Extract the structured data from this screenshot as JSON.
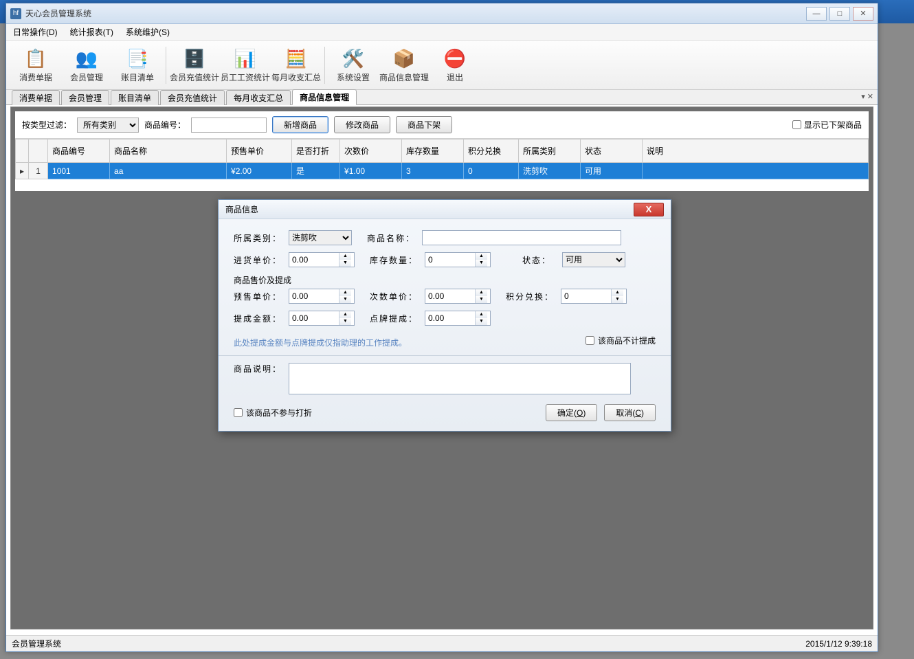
{
  "window": {
    "title": "天心会员管理系统"
  },
  "menubar": {
    "daily": "日常操作(D)",
    "report": "统计报表(T)",
    "maint": "系统维护(S)"
  },
  "toolbar": {
    "consume": "消费单据",
    "member": "会员管理",
    "ledger": "账目清单",
    "recharge": "会员充值统计",
    "salary": "员工工资统计",
    "monthly": "每月收支汇总",
    "settings": "系统设置",
    "goods": "商品信息管理",
    "exit": "退出"
  },
  "tabs": {
    "t1": "消费单据",
    "t2": "会员管理",
    "t3": "账目清单",
    "t4": "会员充值统计",
    "t5": "每月收支汇总",
    "t6": "商品信息管理"
  },
  "filter": {
    "byType": "按类型过滤：",
    "allCat": "所有类别",
    "codeLabel": "商品编号：",
    "add": "新增商品",
    "edit": "修改商品",
    "off": "商品下架",
    "showOff": "显示已下架商品"
  },
  "columns": {
    "code": "商品编号",
    "name": "商品名称",
    "price": "预售单价",
    "discount": "是否打折",
    "tprice": "次数价",
    "stock": "库存数量",
    "exchange": "积分兑换",
    "cat": "所属类别",
    "status": "状态",
    "desc": "说明"
  },
  "row": {
    "idx": "1",
    "code": "1001",
    "name": "aa",
    "price": "¥2.00",
    "discount": "是",
    "tprice": "¥1.00",
    "stock": "3",
    "exchange": "0",
    "cat": "洗剪吹",
    "status": "可用",
    "desc": ""
  },
  "dialog": {
    "title": "商品信息",
    "catLabel": "所属类别：",
    "catValue": "洗剪吹",
    "nameLabel": "商品名称：",
    "nameValue": "",
    "inPriceLabel": "进货单价：",
    "inPriceValue": "0.00",
    "stockLabel": "库存数量：",
    "stockValue": "0",
    "statusLabel": "状态：",
    "statusValue": "可用",
    "section": "商品售价及提成",
    "preLabel": "预售单价：",
    "preValue": "0.00",
    "timesLabel": "次数单价：",
    "timesValue": "0.00",
    "exchLabel": "积分兑换：",
    "exchValue": "0",
    "bonusLabel": "提成金额：",
    "bonusValue": "0.00",
    "cardLabel": "点牌提成：",
    "cardValue": "0.00",
    "note": "此处提成金额与点牌提成仅指助理的工作提成。",
    "nocomm": "该商品不计提成",
    "descLabel": "商品说明：",
    "descValue": "",
    "nodisc": "该商品不参与打折",
    "ok": "确定(O)",
    "cancel": "取消(C)"
  },
  "status": {
    "left": "会员管理系统",
    "time": "2015/1/12 9:39:18"
  }
}
